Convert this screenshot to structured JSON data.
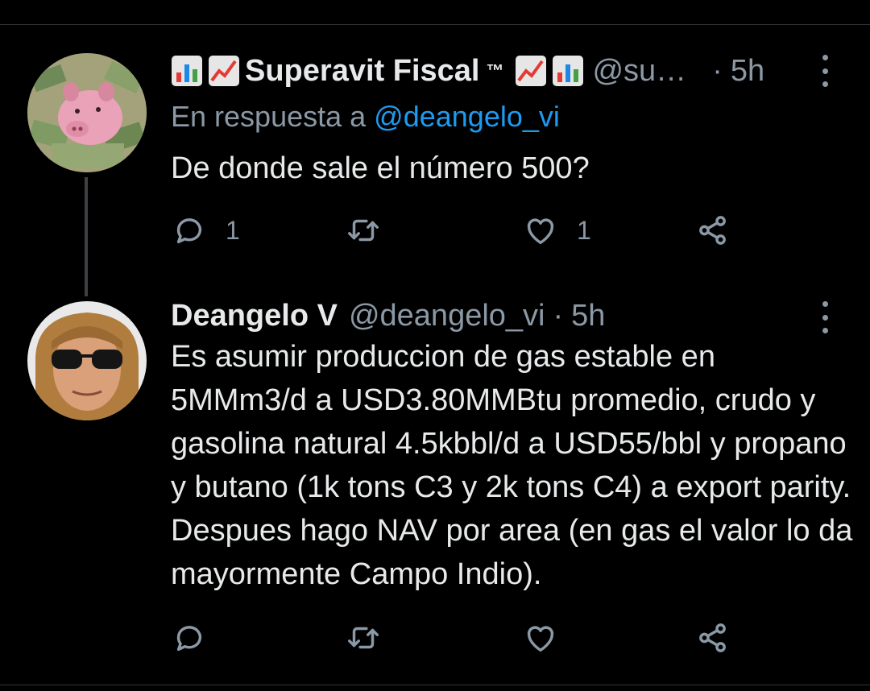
{
  "tweets": [
    {
      "display_name": "Superavit Fiscal",
      "trademark": "™",
      "handle": "@su…",
      "separator": "·",
      "time": "5h",
      "name_icons": [
        "bar-chart-emoji-icon",
        "chart-increasing-emoji-icon"
      ],
      "reply_prefix": "En respuesta a",
      "reply_mention": "@deangelo_vi",
      "text": "De donde sale el número 500?",
      "reply_count": "1",
      "retweet_count": "",
      "like_count": "1"
    },
    {
      "display_name": "Deangelo V",
      "handle": "@deangelo_vi",
      "separator": "·",
      "time": "5h",
      "text": "Es asumir produccion de gas estable en 5MMm3/d a USD3.80MMBtu promedio, crudo y gasolina natural 4.5kbbl/d a USD55/bbl y propano y butano (1k tons C3 y 2k tons C4) a export parity. Despues hago NAV por area (en gas el valor lo da mayormente Campo Indio).",
      "reply_count": "",
      "retweet_count": "",
      "like_count": ""
    }
  ],
  "colors": {
    "background": "#000000",
    "text": "#e7e9ea",
    "secondary": "#8b98a5",
    "link": "#1d9bf0"
  }
}
